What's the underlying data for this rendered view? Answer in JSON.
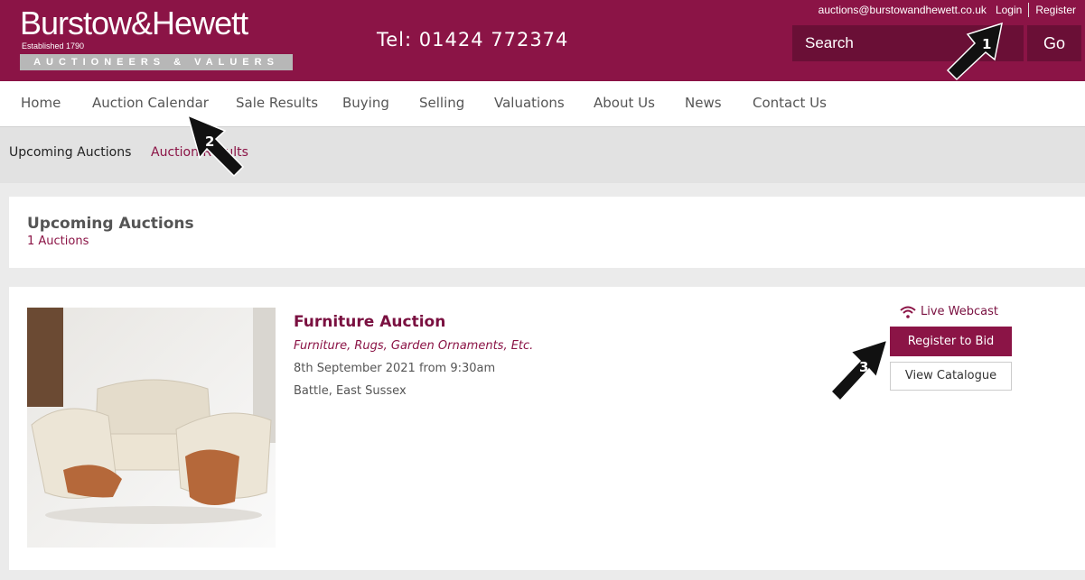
{
  "header": {
    "logo_name": "Burstow&Hewett",
    "logo_established": "Established 1790",
    "logo_tagline": "AUCTIONEERS & VALUERS",
    "tel": "Tel: 01424 772374",
    "email": "auctions@burstowandhewett.co.uk",
    "login": "Login",
    "register": "Register",
    "search_placeholder": "Search",
    "go_label": "Go"
  },
  "nav": {
    "items": [
      "Home",
      "Auction Calendar",
      "Sale Results",
      "Buying",
      "Selling",
      "Valuations",
      "About Us",
      "News",
      "Contact Us"
    ]
  },
  "subnav": {
    "items": [
      "Upcoming Auctions",
      "Auction Results"
    ]
  },
  "listing": {
    "title": "Upcoming Auctions",
    "count": "1 Auctions"
  },
  "auction": {
    "title": "Furniture Auction",
    "subtitle": "Furniture, Rugs, Garden Ornaments, Etc.",
    "date": "8th September 2021 from 9:30am",
    "location": "Battle, East Sussex",
    "webcast": "Live Webcast",
    "register_button": "Register to Bid",
    "catalogue_button": "View Catalogue"
  },
  "annotations": [
    "1",
    "2",
    "3"
  ],
  "colors": {
    "brand": "#8b1446",
    "brand_dark": "#6a0f36"
  }
}
